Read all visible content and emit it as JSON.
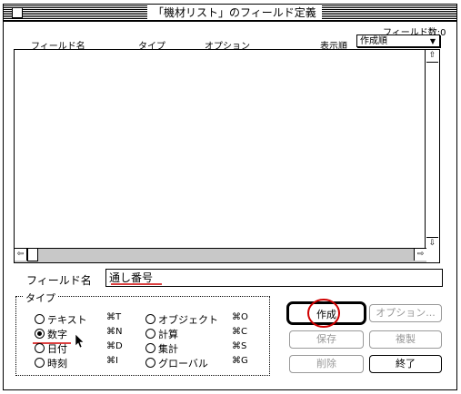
{
  "window": {
    "title": "「機材リスト」のフィールド定義"
  },
  "field_count": "フィールド数:0",
  "columns": {
    "name": "フィールド名",
    "type": "タイプ",
    "option": "オプション",
    "sort_label": "表示順"
  },
  "sort_select": {
    "value": "作成順"
  },
  "field_name": {
    "label": "フィールド名",
    "value": "通し番号"
  },
  "type_group": {
    "label": "タイプ",
    "options": [
      {
        "label": "テキスト",
        "shortcut": "⌘T",
        "selected": false
      },
      {
        "label": "数字",
        "shortcut": "⌘N",
        "selected": true
      },
      {
        "label": "日付",
        "shortcut": "⌘D",
        "selected": false
      },
      {
        "label": "時刻",
        "shortcut": "⌘I",
        "selected": false
      },
      {
        "label": "オブジェクト",
        "shortcut": "⌘O",
        "selected": false
      },
      {
        "label": "計算",
        "shortcut": "⌘C",
        "selected": false
      },
      {
        "label": "集計",
        "shortcut": "⌘S",
        "selected": false
      },
      {
        "label": "グローバル",
        "shortcut": "⌘G",
        "selected": false
      }
    ]
  },
  "buttons": {
    "create": "作成",
    "options": "オプション...",
    "save": "保存",
    "duplicate": "複製",
    "delete": "削除",
    "done": "終了"
  }
}
